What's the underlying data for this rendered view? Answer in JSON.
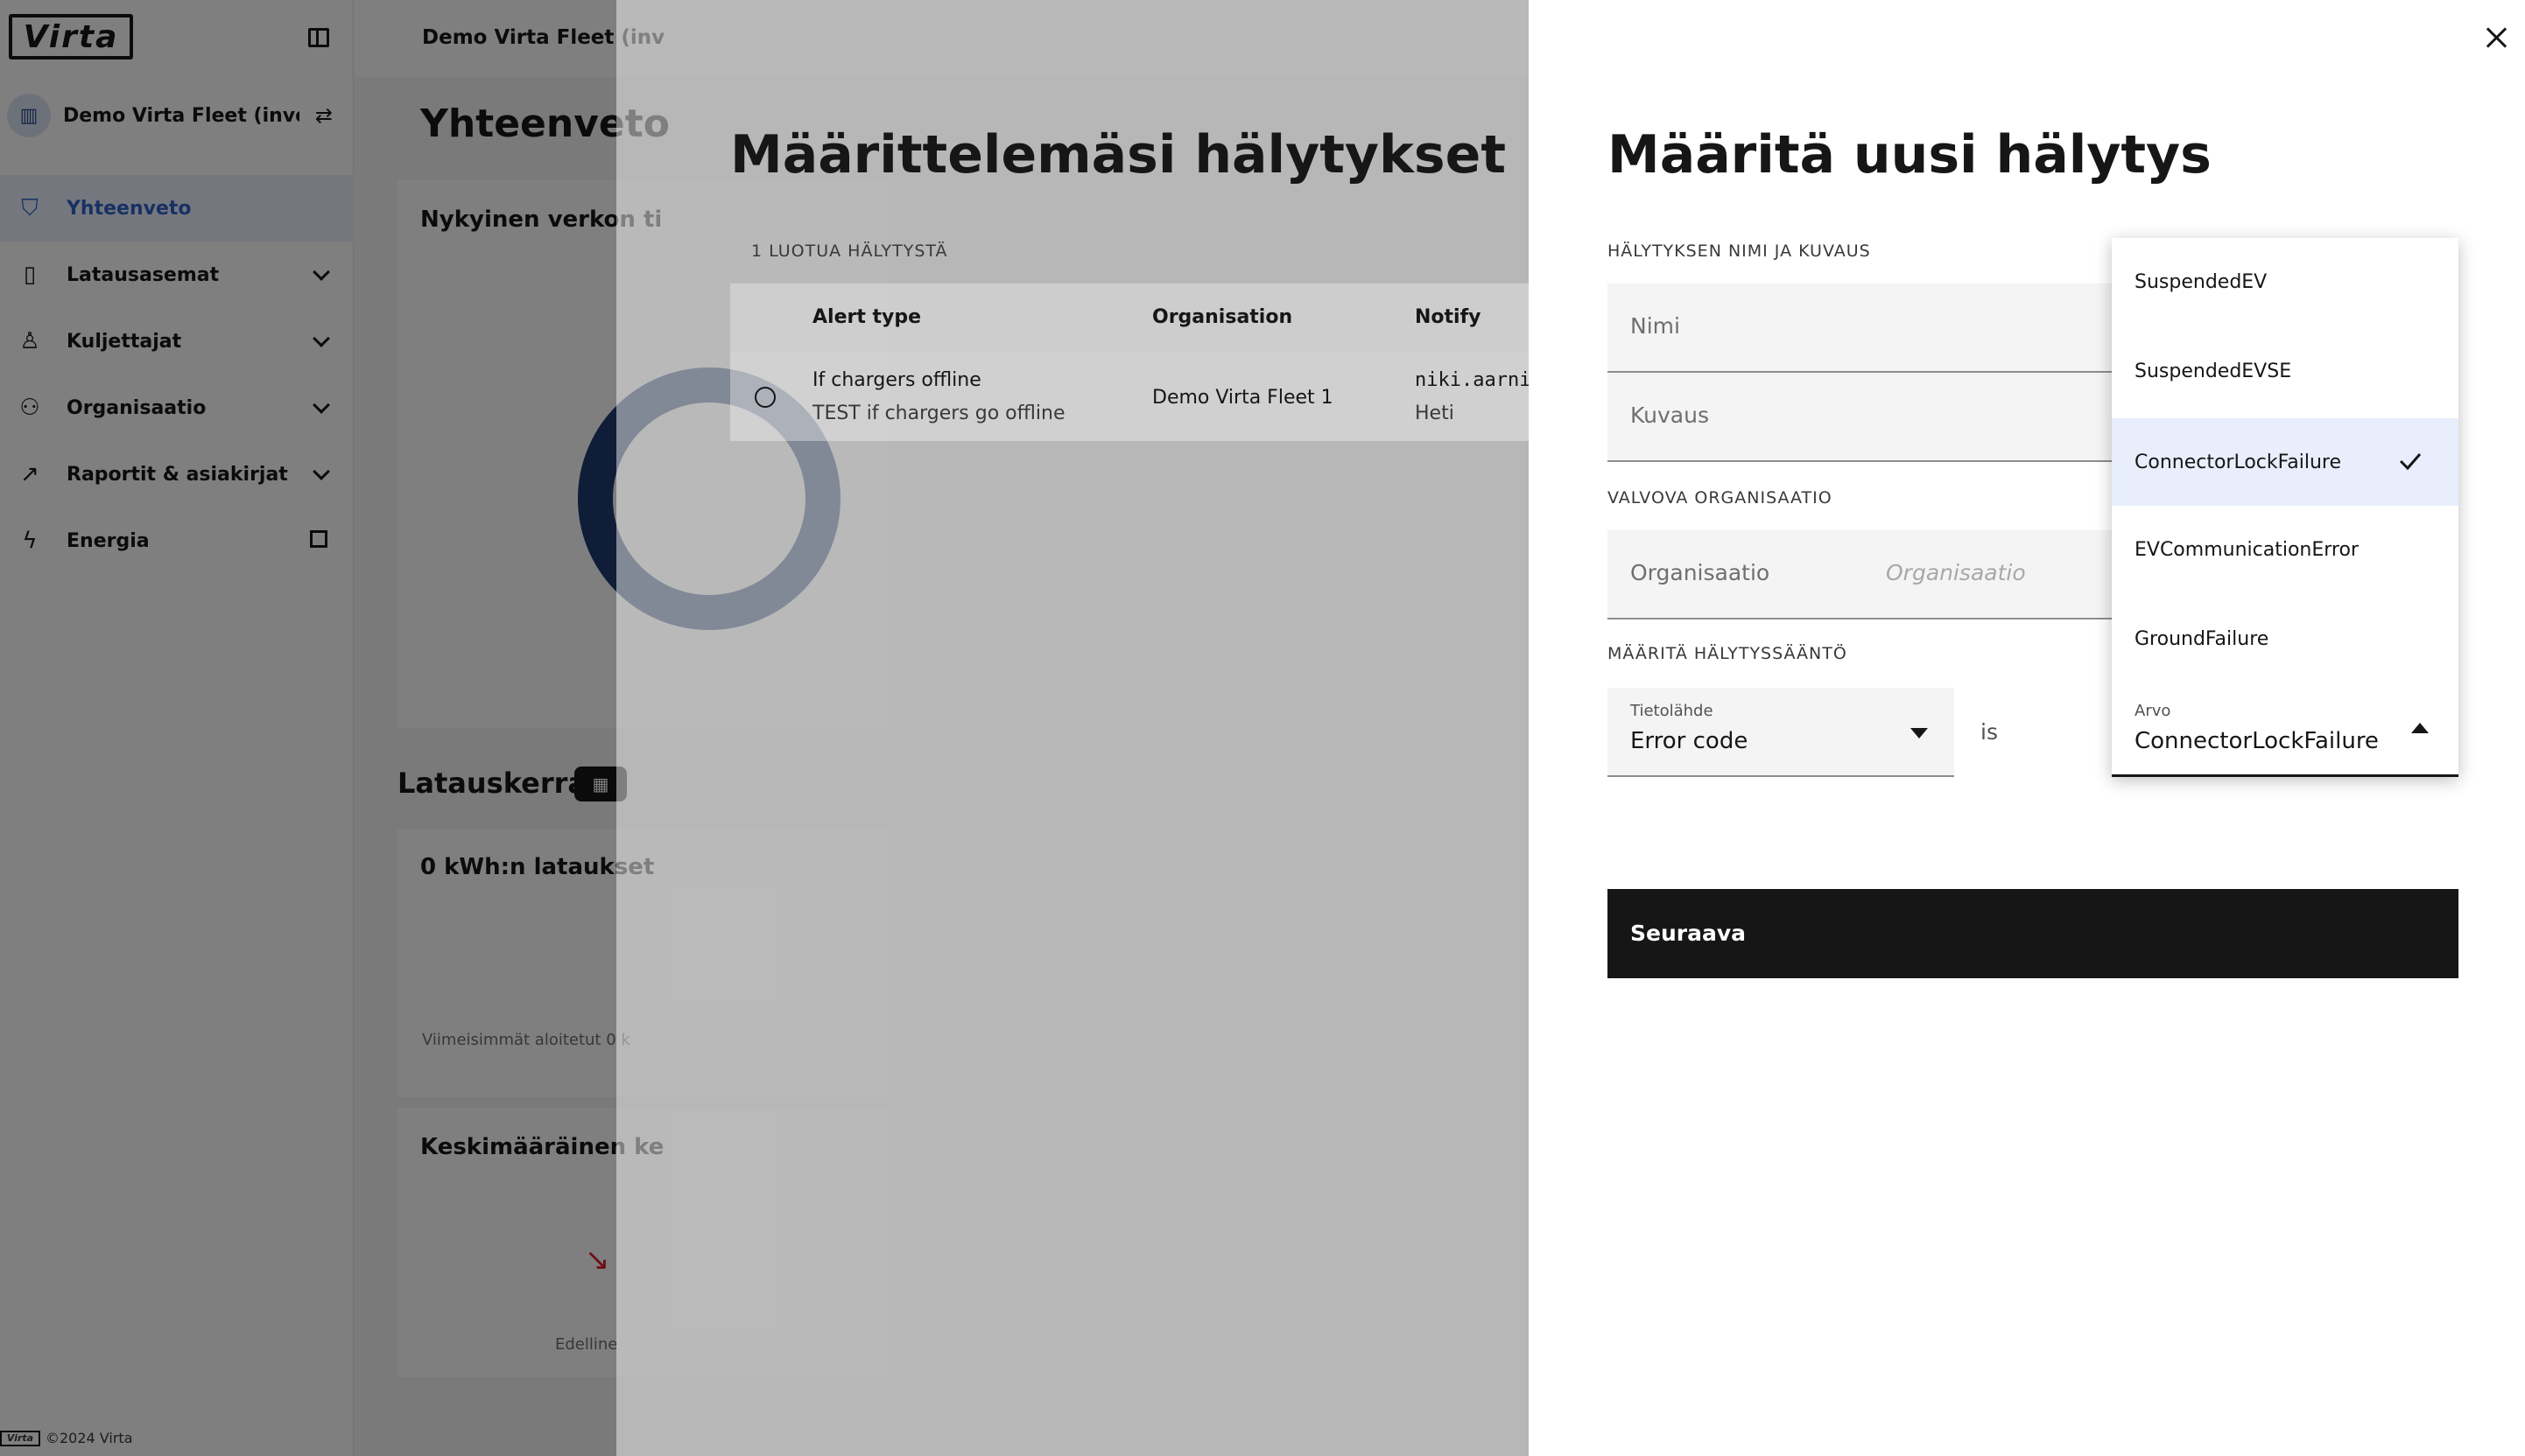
{
  "sidebar": {
    "logo_text": "Virta",
    "org_name": "Demo Virta Fleet (invoi...",
    "items": [
      {
        "label": "Yhteenveto",
        "icon": "presentation-icon",
        "active": true
      },
      {
        "label": "Latausasemat",
        "icon": "charger-icon"
      },
      {
        "label": "Kuljettajat",
        "icon": "driver-icon"
      },
      {
        "label": "Organisaatio",
        "icon": "organisation-icon"
      },
      {
        "label": "Raportit & asiakirjat",
        "icon": "chart-icon"
      },
      {
        "label": "Energia",
        "icon": "lightning-icon"
      }
    ],
    "footer_logo": "Virta",
    "footer_text": "©2024 Virta"
  },
  "dashboard": {
    "topbar_title": "Demo Virta Fleet (inv",
    "page_title": "Yhteenveto",
    "card1_title": "Nykyinen verkon ti",
    "section_title": "Latauskerrat",
    "card2_title": "0 kWh:n lataukset",
    "card2_note": "Viimeisimmät aloitetut 0 k",
    "card3_title": "Keskimääräinen ke",
    "card3_note": "Edelline"
  },
  "alerts_panel": {
    "title": "Määrittelemäsi hälytykset",
    "count_label": "1 LUOTUA HÄLYTYSTÄ",
    "columns": [
      "Alert type",
      "Organisation",
      "Notify"
    ],
    "rows": [
      {
        "alert_type": "If chargers offline",
        "description": "TEST if chargers go offline",
        "organisation": "Demo Virta Fleet 1",
        "notify": "niki.aarni",
        "notify_timing": "Heti"
      }
    ]
  },
  "new_alert": {
    "title": "Määritä uusi hälytys",
    "name_section": "HÄLYTYKSEN NIMI JA KUVAUS",
    "name_placeholder": "Nimi",
    "desc_placeholder": "Kuvaus",
    "org_section": "VALVOVA ORGANISAATIO",
    "org_label": "Organisaatio",
    "org_placeholder": "Organisaatio",
    "rule_section": "MÄÄRITÄ HÄLYTYSSÄÄNTÖ",
    "source_label": "Tietolähde",
    "source_value": "Error code",
    "operator": "is",
    "value_label": "Arvo",
    "value_selected": "ConnectorLockFailure",
    "next_label": "Seuraava",
    "options": [
      "SuspendedEV",
      "SuspendedEVSE",
      "ConnectorLockFailure",
      "EVCommunicationError",
      "GroundFailure"
    ]
  }
}
